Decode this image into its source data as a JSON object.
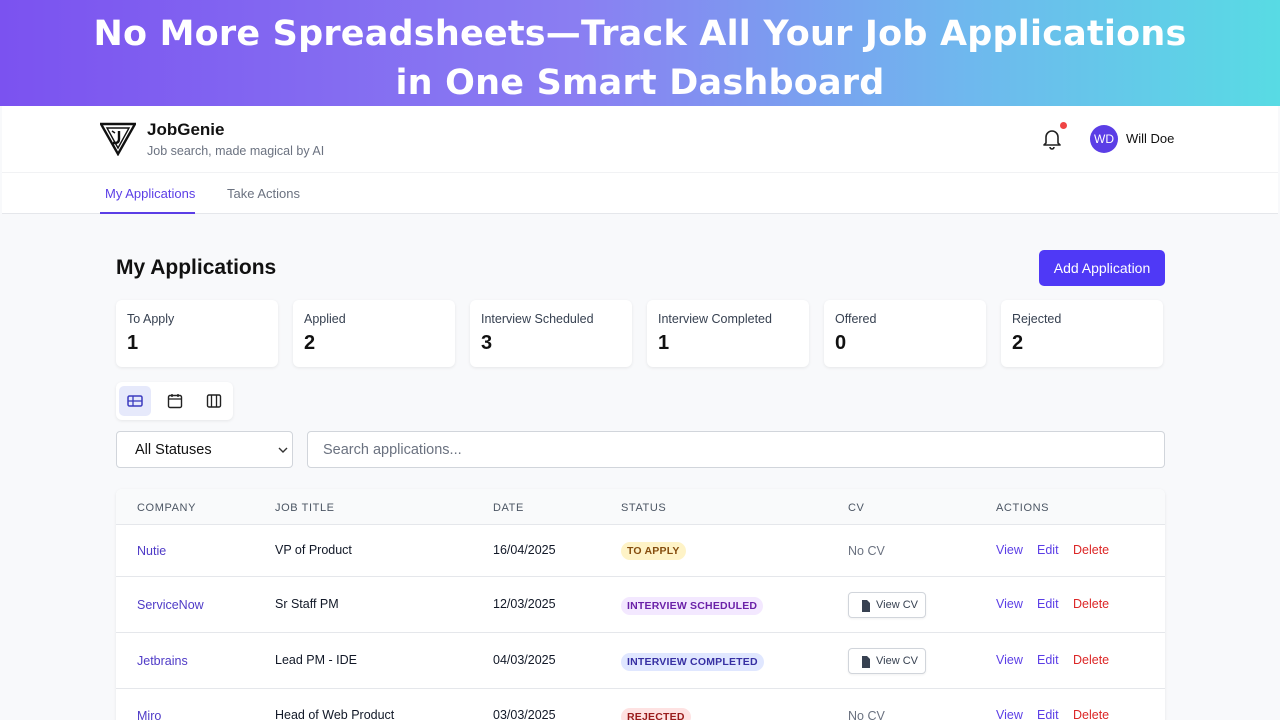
{
  "banner": {
    "line1": "No More Spreadsheets—Track All Your Job Applications",
    "line2": "in One Smart Dashboard"
  },
  "app": {
    "brand_name": "JobGenie",
    "brand_tagline": "Job search, made magical by AI",
    "user": {
      "initials": "WD",
      "name": "Will Doe"
    },
    "notification_dot_color": "#ef4444",
    "accent": "#4f39f6"
  },
  "tabs": [
    {
      "label": "My Applications",
      "active": true
    },
    {
      "label": "Take Actions",
      "active": false
    }
  ],
  "page": {
    "title": "My Applications",
    "add_button": "Add Application"
  },
  "stats": [
    {
      "label": "To Apply",
      "value": "1"
    },
    {
      "label": "Applied",
      "value": "2"
    },
    {
      "label": "Interview Scheduled",
      "value": "3"
    },
    {
      "label": "Interview Completed",
      "value": "1"
    },
    {
      "label": "Offered",
      "value": "0"
    },
    {
      "label": "Rejected",
      "value": "2"
    }
  ],
  "view_modes": [
    "table-icon",
    "calendar-icon",
    "kanban-icon"
  ],
  "filters": {
    "status_selected": "All Statuses",
    "search_placeholder": "Search applications..."
  },
  "table": {
    "columns": [
      "COMPANY",
      "JOB TITLE",
      "DATE",
      "STATUS",
      "CV",
      "ACTIONS"
    ],
    "actions": {
      "view": "View",
      "edit": "Edit",
      "delete": "Delete"
    },
    "cv_button": "View CV",
    "rows": [
      {
        "company": "Nutie",
        "job_title": "VP of Product",
        "date": "16/04/2025",
        "status": "TO APPLY",
        "cv": "No CV"
      },
      {
        "company": "ServiceNow",
        "job_title": "Sr Staff PM",
        "date": "12/03/2025",
        "status": "INTERVIEW SCHEDULED",
        "cv": "View CV"
      },
      {
        "company": "Jetbrains",
        "job_title": "Lead PM - IDE",
        "date": "04/03/2025",
        "status": "INTERVIEW COMPLETED",
        "cv": "View CV"
      },
      {
        "company": "Miro",
        "job_title": "Head of Web Product",
        "date": "03/03/2025",
        "status": "REJECTED",
        "cv": "No CV"
      }
    ]
  }
}
